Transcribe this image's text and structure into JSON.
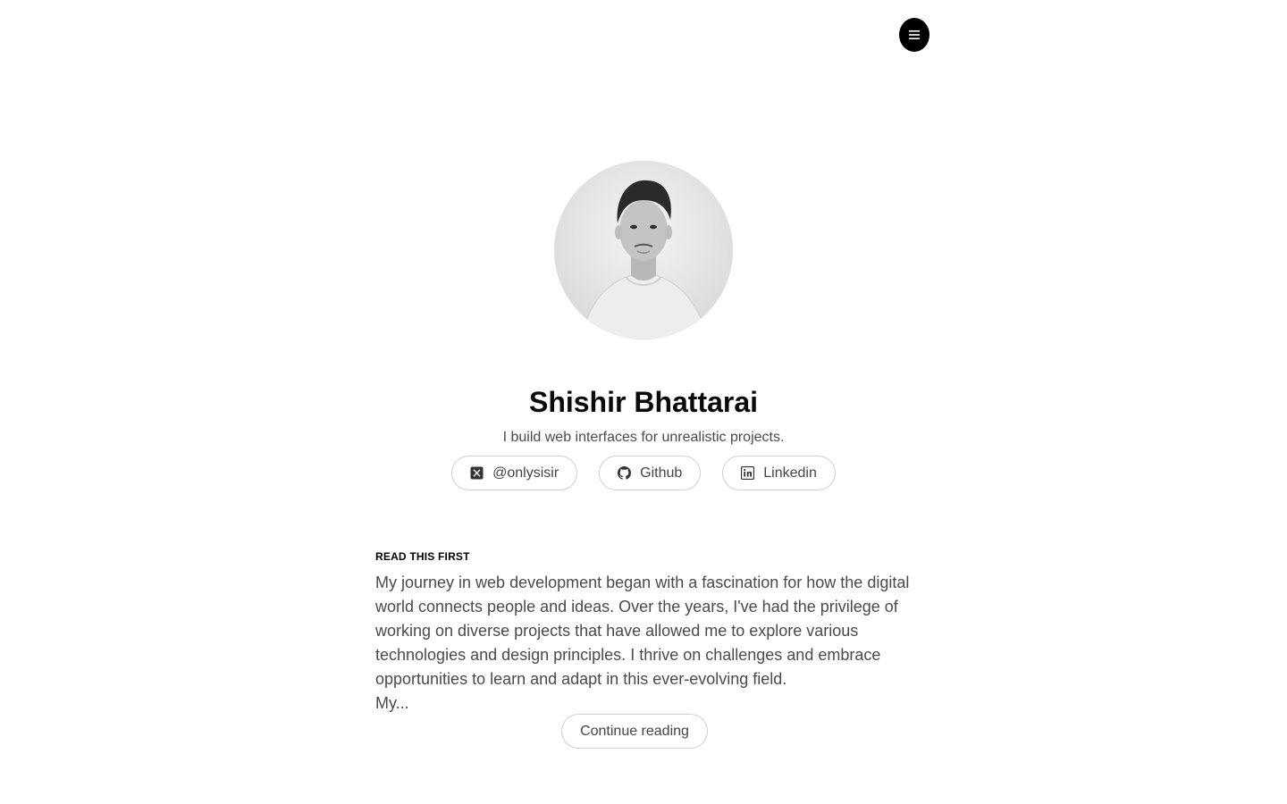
{
  "header": {
    "menu_icon": "hamburger-menu-icon"
  },
  "profile": {
    "avatar_description": "portrait-photo",
    "name": "Shishir Bhattarai",
    "tagline": "I build web interfaces for unrealistic projects."
  },
  "socials": [
    {
      "icon": "x-logo-icon",
      "label": "@onlysisir"
    },
    {
      "icon": "github-icon",
      "label": "Github"
    },
    {
      "icon": "linkedin-icon",
      "label": "Linkedin"
    }
  ],
  "intro": {
    "section_label": "READ THIS FIRST",
    "excerpt": "My journey in web development began with a fascination for how the digital world connects people and ideas. Over the years, I've had the privilege of working on diverse projects that have allowed me to explore various technologies and design principles. I thrive on challenges and embrace opportunities to learn and adapt in this ever-evolving field.",
    "excerpt_tail": "My...",
    "continue_label": "Continue reading"
  },
  "colors": {
    "background": "#ffffff",
    "menu_button": "#000000",
    "text_primary": "#0a0a0a",
    "text_secondary": "#4a4a4a",
    "pill_border": "#cfcfcf"
  }
}
